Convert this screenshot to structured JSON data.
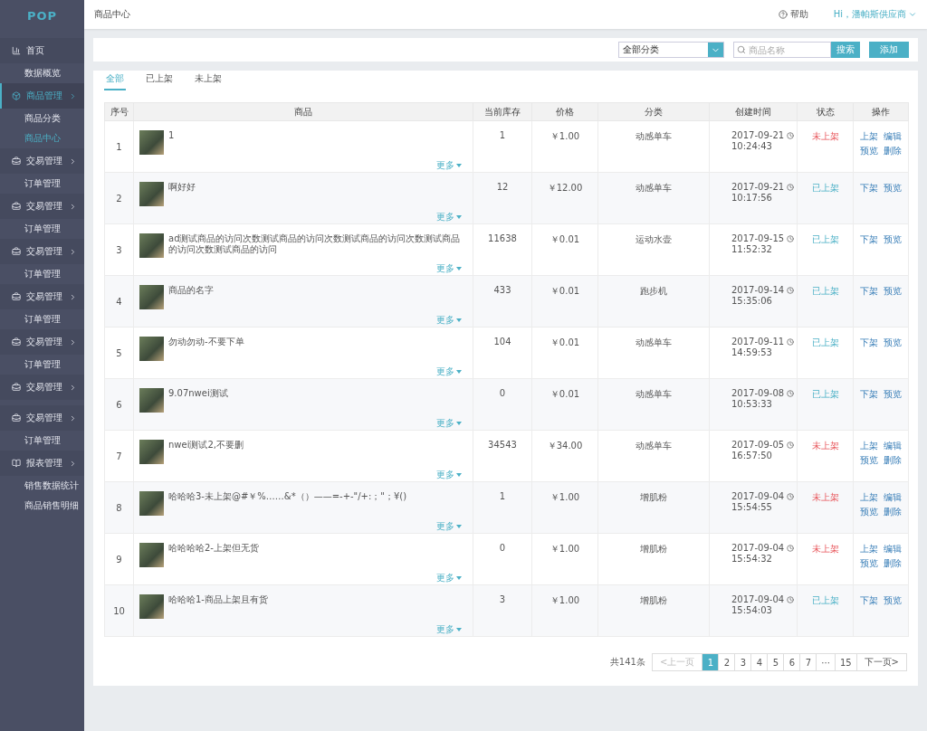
{
  "logo": "POP",
  "sidebar": {
    "items": [
      {
        "kind": "home",
        "label": "首页",
        "selected": false,
        "chevron": false,
        "children": [
          {
            "label": "数据概览",
            "selected": false
          }
        ]
      },
      {
        "kind": "goods",
        "label": "商品管理",
        "selected": true,
        "chevron": true,
        "children": [
          {
            "label": "商品分类",
            "selected": false
          },
          {
            "label": "商品中心",
            "selected": true
          }
        ]
      },
      {
        "kind": "trade",
        "label": "交易管理",
        "selected": false,
        "chevron": true,
        "children": [
          {
            "label": "订单管理",
            "selected": false
          }
        ]
      },
      {
        "kind": "trade",
        "label": "交易管理",
        "selected": false,
        "chevron": true,
        "children": [
          {
            "label": "订单管理",
            "selected": false
          }
        ]
      },
      {
        "kind": "trade",
        "label": "交易管理",
        "selected": false,
        "chevron": true,
        "children": [
          {
            "label": "订单管理",
            "selected": false
          }
        ]
      },
      {
        "kind": "trade",
        "label": "交易管理",
        "selected": false,
        "chevron": true,
        "children": [
          {
            "label": "订单管理",
            "selected": false
          }
        ]
      },
      {
        "kind": "trade",
        "label": "交易管理",
        "selected": false,
        "chevron": true,
        "children": [
          {
            "label": "订单管理",
            "selected": false
          }
        ]
      },
      {
        "kind": "trade",
        "label": "交易管理",
        "selected": false,
        "chevron": true
      },
      {
        "kind": "trade",
        "label": "交易管理",
        "selected": false,
        "chevron": true,
        "children": [
          {
            "label": "订单管理",
            "selected": false
          }
        ]
      },
      {
        "kind": "report",
        "label": "报表管理",
        "selected": false,
        "chevron": true,
        "children": [
          {
            "label": "销售数据统计",
            "selected": false
          },
          {
            "label": "商品销售明细",
            "selected": false
          }
        ]
      }
    ]
  },
  "header": {
    "title": "商品中心",
    "help": "帮助",
    "user": "Hi，潘帕斯供应商"
  },
  "toolbar": {
    "category": "全部分类",
    "search_placeholder": "商品名称",
    "search_button": "搜索",
    "add_button": "添加"
  },
  "tabs": [
    {
      "label": "全部",
      "selected": true
    },
    {
      "label": "已上架",
      "selected": false
    },
    {
      "label": "未上架",
      "selected": false
    }
  ],
  "table": {
    "columns": [
      "序号",
      "商品",
      "当前库存",
      "价格",
      "分类",
      "创建时间",
      "状态",
      "操作"
    ],
    "rows": [
      {
        "index": "1",
        "name": "1",
        "more": "更多",
        "stock": "1",
        "price": "￥1.00",
        "category": "动感单车",
        "date": "2017-09-21",
        "time": "10:24:43",
        "status": "未上架",
        "listed": false,
        "actions": [
          "上架",
          "编辑",
          "预览",
          "删除"
        ]
      },
      {
        "index": "2",
        "name": "啊好好",
        "more": "更多",
        "stock": "12",
        "price": "￥12.00",
        "category": "动感单车",
        "date": "2017-09-21",
        "time": "10:17:56",
        "status": "已上架",
        "listed": true,
        "actions": [
          "下架",
          "预览"
        ]
      },
      {
        "index": "3",
        "name": "ad测试商品的访问次数测试商品的访问次数测试商品的访问次数测试商品的访问次数测试商品的访问",
        "more": "更多",
        "stock": "11638",
        "price": "￥0.01",
        "category": "运动水壶",
        "date": "2017-09-15",
        "time": "11:52:32",
        "status": "已上架",
        "listed": true,
        "actions": [
          "下架",
          "预览"
        ]
      },
      {
        "index": "4",
        "name": "商品的名字",
        "more": "更多",
        "stock": "433",
        "price": "￥0.01",
        "category": "跑步机",
        "date": "2017-09-14",
        "time": "15:35:06",
        "status": "已上架",
        "listed": true,
        "actions": [
          "下架",
          "预览"
        ]
      },
      {
        "index": "5",
        "name": "勿动勿动-不要下单",
        "more": "更多",
        "stock": "104",
        "price": "￥0.01",
        "category": "动感单车",
        "date": "2017-09-11",
        "time": "14:59:53",
        "status": "已上架",
        "listed": true,
        "actions": [
          "下架",
          "预览"
        ]
      },
      {
        "index": "6",
        "name": "9.07nwei测试",
        "more": "更多",
        "stock": "0",
        "price": "￥0.01",
        "category": "动感单车",
        "date": "2017-09-08",
        "time": "10:53:33",
        "status": "已上架",
        "listed": true,
        "actions": [
          "下架",
          "预览"
        ]
      },
      {
        "index": "7",
        "name": "nwei测试2,不要删",
        "more": "更多",
        "stock": "34543",
        "price": "￥34.00",
        "category": "动感单车",
        "date": "2017-09-05",
        "time": "16:57:50",
        "status": "未上架",
        "listed": false,
        "actions": [
          "上架",
          "编辑",
          "预览",
          "删除"
        ]
      },
      {
        "index": "8",
        "name": "哈哈哈3-未上架@#￥%……&*（）——=-+-\"/+:；\"；¥()",
        "more": "更多",
        "stock": "1",
        "price": "￥1.00",
        "category": "增肌粉",
        "date": "2017-09-04",
        "time": "15:54:55",
        "status": "未上架",
        "listed": false,
        "actions": [
          "上架",
          "编辑",
          "预览",
          "删除"
        ]
      },
      {
        "index": "9",
        "name": "哈哈哈哈2-上架但无货",
        "more": "更多",
        "stock": "0",
        "price": "￥1.00",
        "category": "增肌粉",
        "date": "2017-09-04",
        "time": "15:54:32",
        "status": "未上架",
        "listed": false,
        "actions": [
          "上架",
          "编辑",
          "预览",
          "删除"
        ]
      },
      {
        "index": "10",
        "name": "哈哈哈1-商品上架且有货",
        "more": "更多",
        "stock": "3",
        "price": "￥1.00",
        "category": "增肌粉",
        "date": "2017-09-04",
        "time": "15:54:03",
        "status": "已上架",
        "listed": true,
        "actions": [
          "下架",
          "预览"
        ]
      }
    ]
  },
  "pagination": {
    "total": "共141条",
    "prev": "<上一页",
    "prev_disabled": true,
    "pages": [
      {
        "label": "1",
        "selected": true
      },
      {
        "label": "2",
        "selected": false
      },
      {
        "label": "3",
        "selected": false
      },
      {
        "label": "4",
        "selected": false
      },
      {
        "label": "5",
        "selected": false
      },
      {
        "label": "6",
        "selected": false
      },
      {
        "label": "7",
        "selected": false
      },
      {
        "label": "···",
        "selected": false
      },
      {
        "label": "15",
        "selected": false
      }
    ],
    "next": "下一页>"
  }
}
